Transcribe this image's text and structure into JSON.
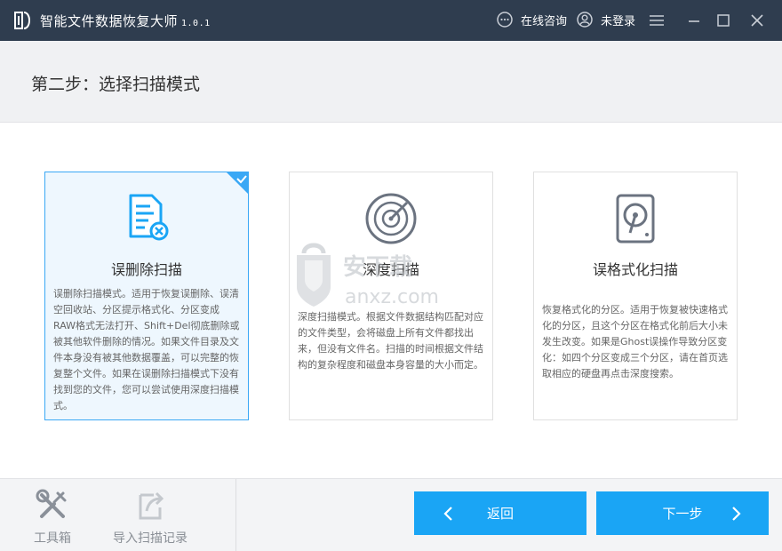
{
  "app": {
    "title": "智能文件数据恢复大师",
    "version": "1.0.1"
  },
  "titlebar": {
    "consult_label": "在线咨询",
    "login_label": "未登录"
  },
  "step": {
    "title": "第二步：选择扫描模式"
  },
  "modes": [
    {
      "title": "误删除扫描",
      "description": "误删除扫描模式。适用于恢复误删除、误清空回收站、分区提示格式化、分区变成RAW格式无法打开、Shift+Del彻底删除或被其他软件删除的情况。如果文件目录及文件本身没有被其他数据覆盖，可以完整的恢复整个文件。如果在误删除扫描模式下没有找到您的文件，您可以尝试使用深度扫描模式。",
      "selected": true
    },
    {
      "title": "深度扫描",
      "description": "深度扫描模式。根据文件数据结构匹配对应的文件类型，会将磁盘上所有文件都找出来，但没有文件名。扫描的时间根据文件结构的复杂程度和磁盘本身容量的大小而定。",
      "selected": false
    },
    {
      "title": "误格式化扫描",
      "description": "恢复格式化的分区。适用于恢复被快速格式化的分区，且这个分区在格式化前后大小未发生改变。如果是Ghost误操作导致分区变化：如四个分区变成三个分区，请在首页选取相应的硬盘再点击深度搜索。",
      "selected": false
    }
  ],
  "watermark": {
    "text_cn": "安下载",
    "text_en": "anxz.com"
  },
  "bottom": {
    "toolbox_label": "工具箱",
    "import_label": "导入扫描记录",
    "back_label": "返回",
    "next_label": "下一步"
  },
  "colors": {
    "titlebar": "#2f3d4f",
    "accent": "#1aa5f5",
    "selected_border": "#3aa8f5",
    "selected_bg": "#eef7fe"
  }
}
